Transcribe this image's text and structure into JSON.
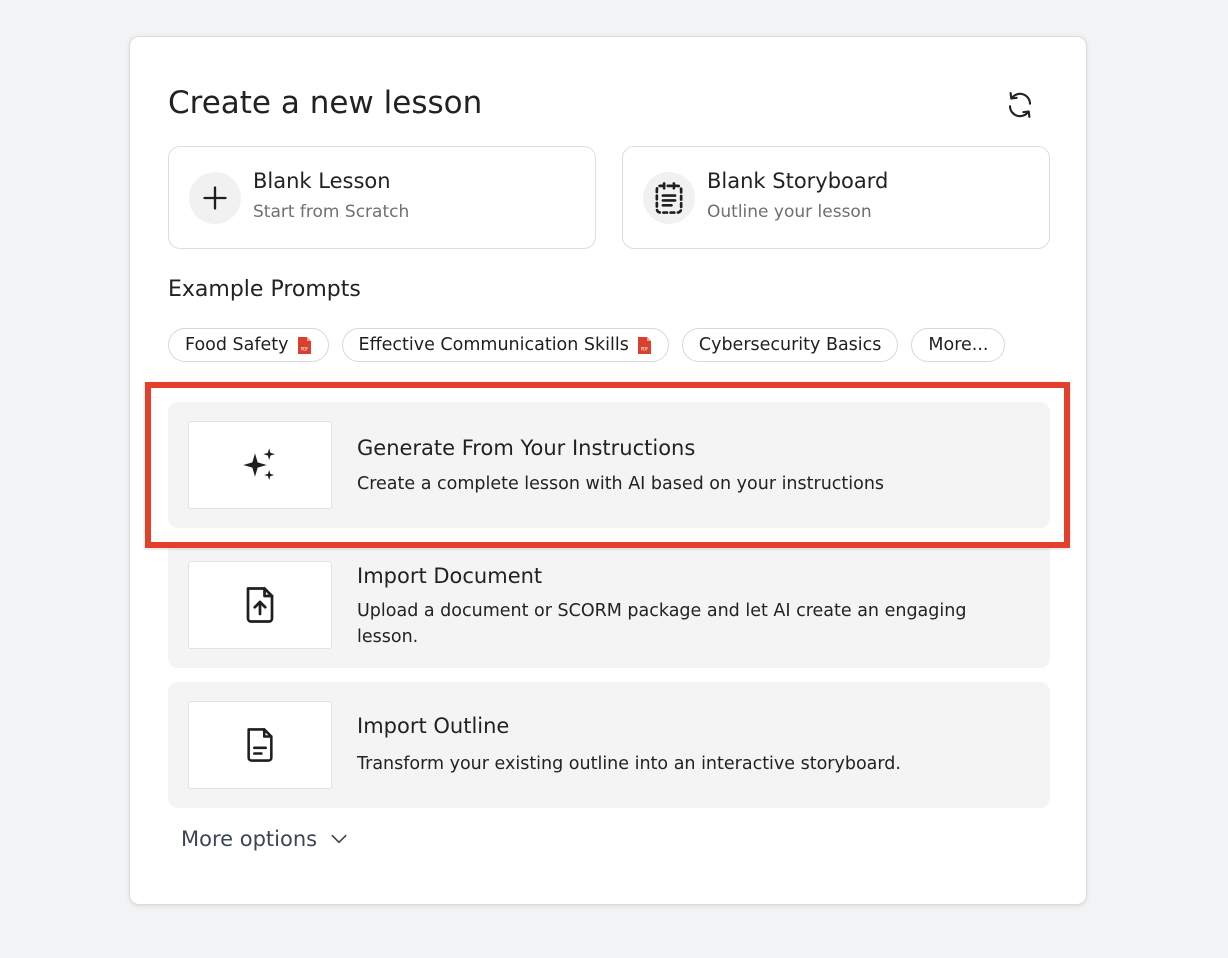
{
  "header": {
    "title": "Create a new lesson",
    "refresh_icon": "refresh-icon"
  },
  "blank_options": [
    {
      "title": "Blank Lesson",
      "subtitle": "Start from Scratch",
      "icon": "plus-icon"
    },
    {
      "title": "Blank Storyboard",
      "subtitle": "Outline your lesson",
      "icon": "storyboard-icon"
    }
  ],
  "example_prompts": {
    "title": "Example Prompts",
    "chips": [
      {
        "label": "Food Safety",
        "has_pdf": true
      },
      {
        "label": "Effective Communication Skills",
        "has_pdf": true
      },
      {
        "label": "Cybersecurity Basics",
        "has_pdf": false
      },
      {
        "label": "More...",
        "has_pdf": false
      }
    ]
  },
  "options": [
    {
      "title": "Generate From Your Instructions",
      "description": "Create a complete lesson with AI based on your instructions",
      "icon": "sparkles-icon",
      "highlighted": true
    },
    {
      "title": "Import Document",
      "description": "Upload a document or SCORM package and let AI create an engaging lesson.",
      "icon": "file-upload-icon"
    },
    {
      "title": "Import Outline",
      "description": "Transform your existing outline into an interactive storyboard.",
      "icon": "file-text-icon"
    }
  ],
  "more_options": {
    "label": "More options",
    "icon": "chevron-down-icon"
  },
  "colors": {
    "highlight": "#e2402b",
    "pdf_red": "#d9412e",
    "background": "#f2f3f5"
  }
}
